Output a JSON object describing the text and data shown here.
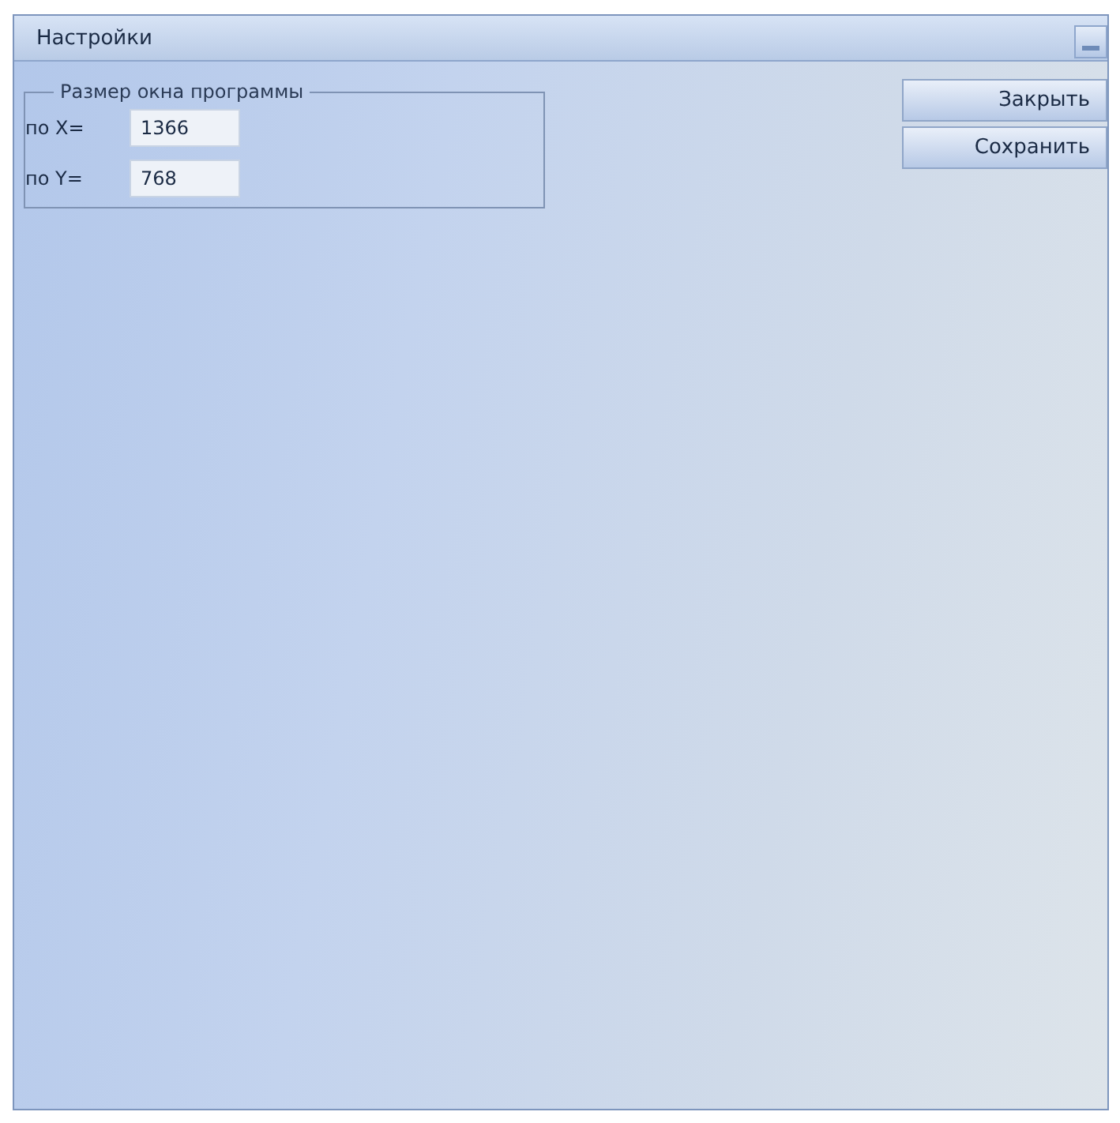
{
  "window": {
    "title": "Настройки"
  },
  "group": {
    "title": "Размер окна программы",
    "fields": [
      {
        "label": "по X=",
        "value": "1366"
      },
      {
        "label": "по Y=",
        "value": "768"
      }
    ]
  },
  "buttons": [
    "Закрыть",
    "Сохранить"
  ]
}
